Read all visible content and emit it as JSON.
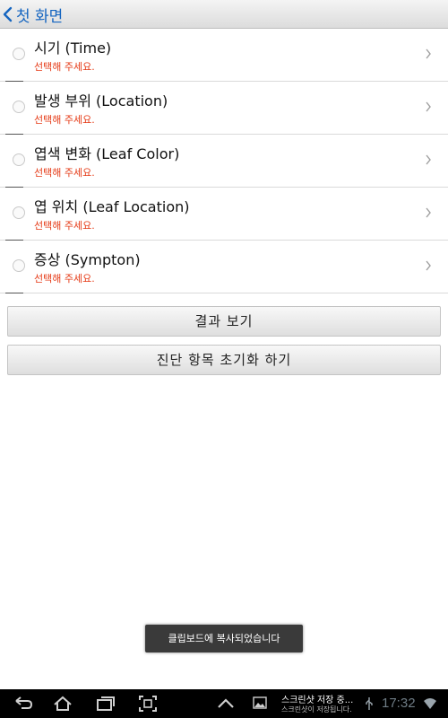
{
  "header": {
    "back_label": "첫 화면"
  },
  "list": {
    "items": [
      {
        "title": "시기 (Time)",
        "subtitle": "선택해 주세요."
      },
      {
        "title": "발생 부위 (Location)",
        "subtitle": "선택해 주세요."
      },
      {
        "title": "엽색 변화 (Leaf Color)",
        "subtitle": "선택해 주세요."
      },
      {
        "title": "엽 위치 (Leaf Location)",
        "subtitle": "선택해 주세요."
      },
      {
        "title": "증상 (Sympton)",
        "subtitle": "선택해 주세요."
      }
    ]
  },
  "buttons": {
    "result_label": "결과 보기",
    "reset_label": "진단 항목 초기화 하기"
  },
  "toast": {
    "message": "클립보드에 복사되었습니다"
  },
  "system_bar": {
    "notification_title": "스크린샷 저장 중...",
    "notification_subtitle": "스크린샷이 저장됩니다.",
    "clock": "17:32",
    "icons": [
      "back-icon",
      "home-icon",
      "recent-apps-icon",
      "screenshot-icon",
      "menu-up-icon",
      "image-icon",
      "usb-icon",
      "wifi-icon"
    ]
  },
  "colors": {
    "accent_blue": "#1565c0",
    "prompt_red": "#e53915",
    "system_bar": "#000000",
    "clock_gray": "#6f7c85"
  }
}
